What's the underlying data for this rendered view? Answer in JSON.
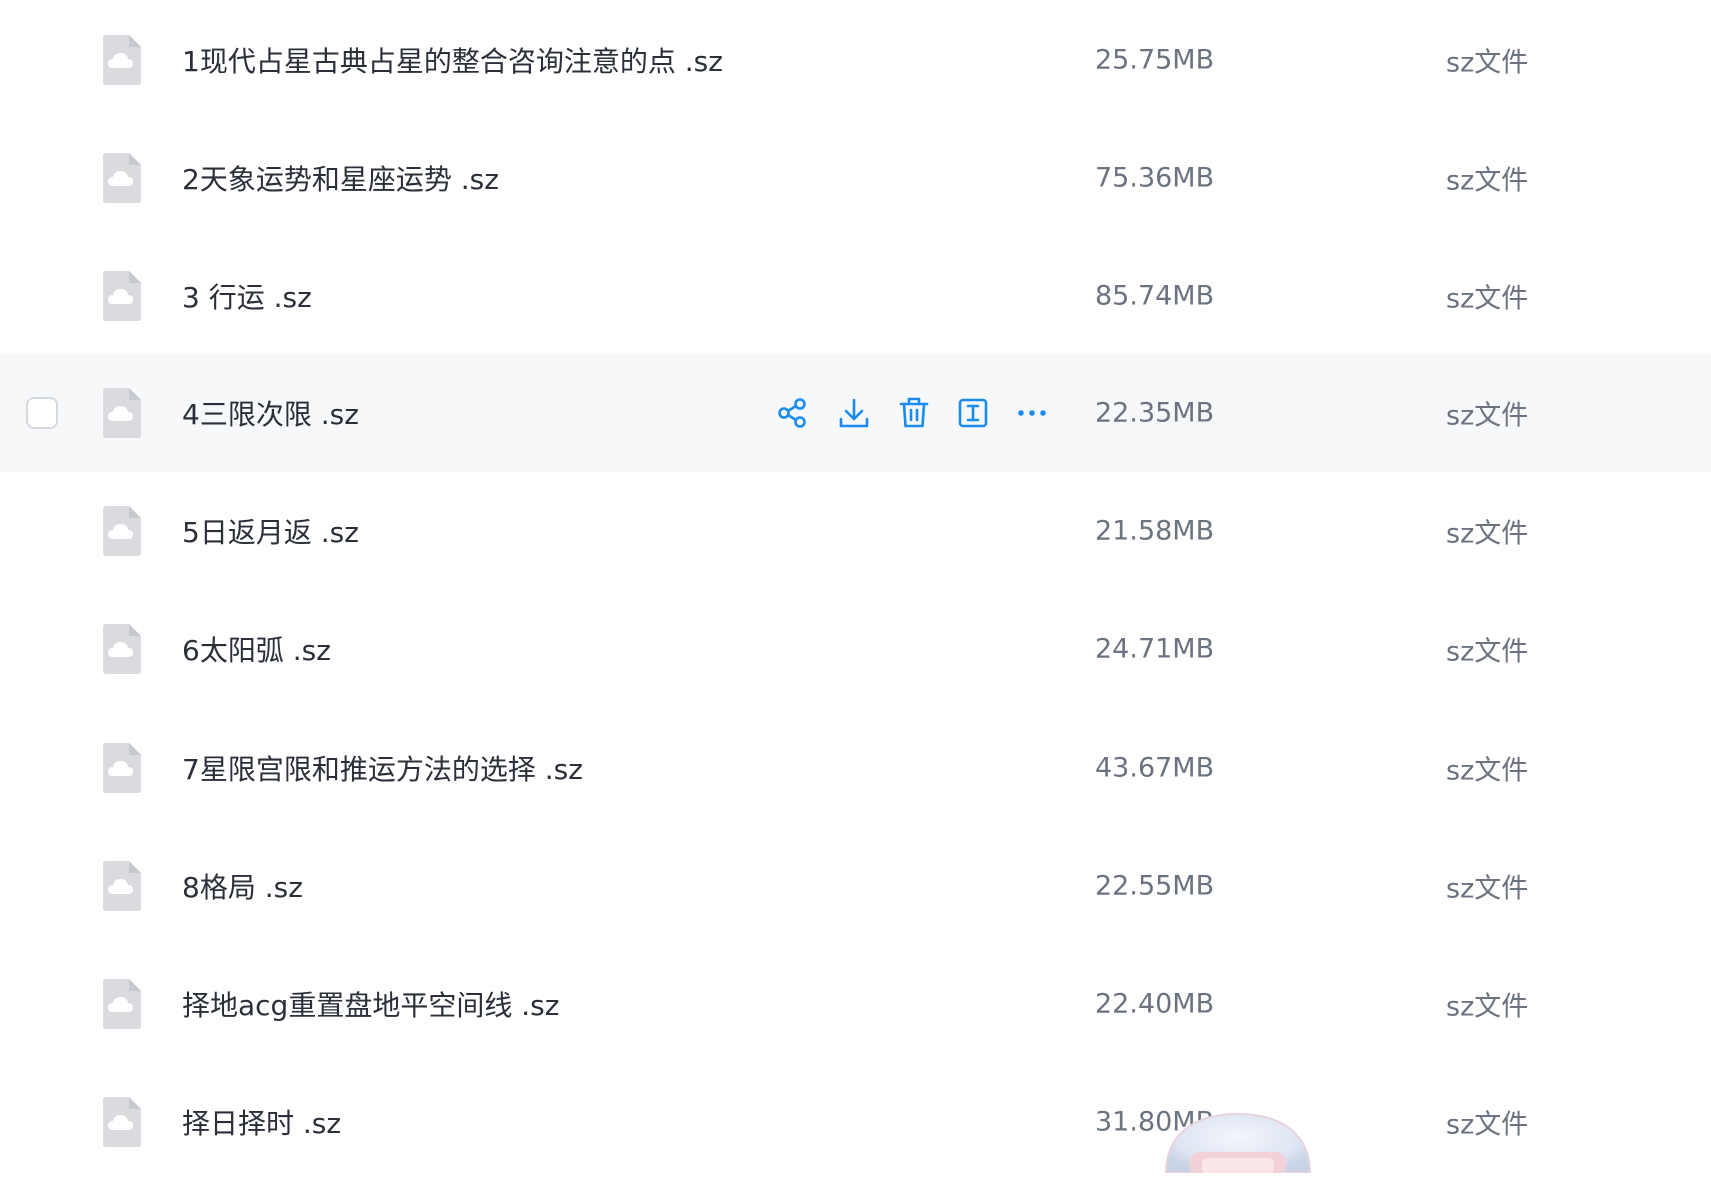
{
  "colors": {
    "accent": "#1a8cf0",
    "hover_row_bg": "#f7f8fa",
    "name_text": "#2a2f3a",
    "meta_text": "#6b7280",
    "icon_gray": "#d9dbdf"
  },
  "hover_actions": [
    {
      "name": "share",
      "icon": "share-icon"
    },
    {
      "name": "download",
      "icon": "download-icon"
    },
    {
      "name": "delete",
      "icon": "trash-icon"
    },
    {
      "name": "rename",
      "icon": "rename-icon"
    },
    {
      "name": "more",
      "icon": "more-icon"
    }
  ],
  "files": [
    {
      "name": "1现代占星古典占星的整合咨询注意的点 .sz",
      "size": "25.75MB",
      "type": "sz文件",
      "icon": "cloud-file-icon"
    },
    {
      "name": "2天象运势和星座运势 .sz",
      "size": "75.36MB",
      "type": "sz文件",
      "icon": "cloud-file-icon"
    },
    {
      "name": "3 行运 .sz",
      "size": "85.74MB",
      "type": "sz文件",
      "icon": "cloud-file-icon"
    },
    {
      "name": "4三限次限 .sz",
      "size": "22.35MB",
      "type": "sz文件",
      "icon": "cloud-file-icon",
      "hovered": true
    },
    {
      "name": "5日返月返 .sz",
      "size": "21.58MB",
      "type": "sz文件",
      "icon": "cloud-file-icon"
    },
    {
      "name": "6太阳弧 .sz",
      "size": "24.71MB",
      "type": "sz文件",
      "icon": "cloud-file-icon"
    },
    {
      "name": "7星限宫限和推运方法的选择 .sz",
      "size": "43.67MB",
      "type": "sz文件",
      "icon": "cloud-file-icon"
    },
    {
      "name": "8格局 .sz",
      "size": "22.55MB",
      "type": "sz文件",
      "icon": "cloud-file-icon"
    },
    {
      "name": "择地acg重置盘地平空间线 .sz",
      "size": "22.40MB",
      "type": "sz文件",
      "icon": "cloud-file-icon"
    },
    {
      "name": "择日择时 .sz",
      "size": "31.80MB",
      "type": "sz文件",
      "icon": "cloud-file-icon"
    }
  ]
}
